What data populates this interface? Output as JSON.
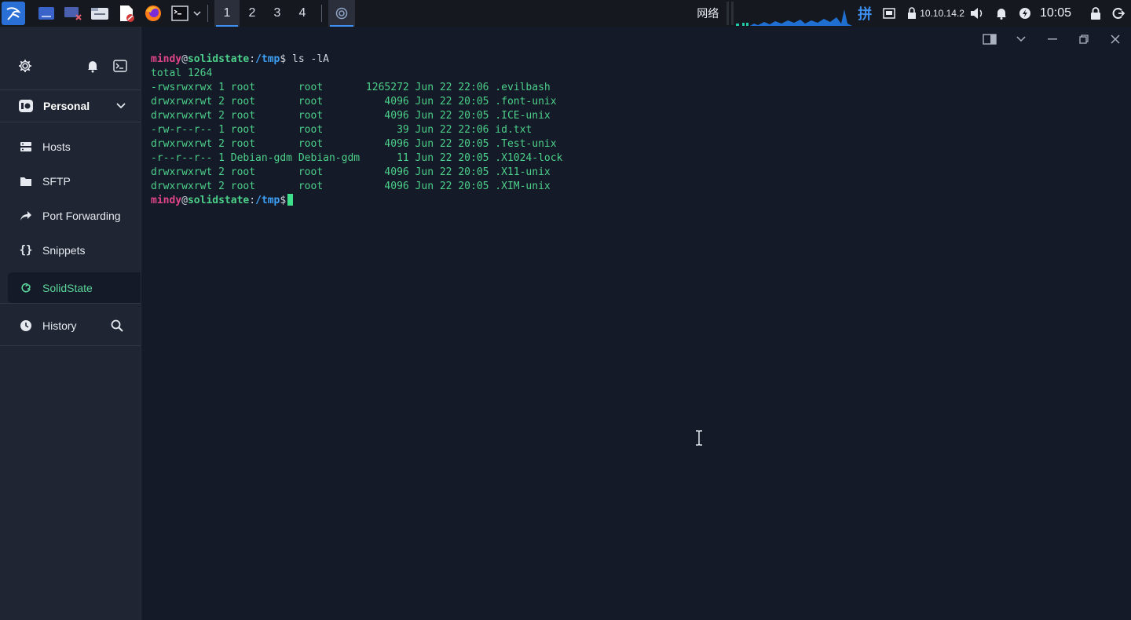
{
  "taskbar": {
    "workspaces": [
      "1",
      "2",
      "3",
      "4"
    ],
    "network_label": "网络",
    "ime_label": "拼",
    "ip_address": "10.10.14.2",
    "clock": "10:05",
    "accent": "#3d8ff0"
  },
  "sidebar": {
    "group_label": "Personal",
    "items": [
      {
        "label": "Hosts",
        "icon": "hosts-icon"
      },
      {
        "label": "SFTP",
        "icon": "folder-icon"
      },
      {
        "label": "Port Forwarding",
        "icon": "port-forward-icon"
      },
      {
        "label": "Snippets",
        "icon": "braces-icon"
      },
      {
        "label": "SolidState",
        "icon": "debian-swirl-icon",
        "selected": true
      },
      {
        "label": "History",
        "icon": "clock-icon"
      }
    ],
    "accent": "#5bd49a"
  },
  "terminal": {
    "prompt_user": "mindy",
    "prompt_at": "@",
    "prompt_host": "solidstate",
    "prompt_colon": ":",
    "prompt_path": "/tmp",
    "prompt_dollar": "$",
    "command": " ls -lA",
    "output": [
      "total 1264",
      "-rwsrwxrwx 1 root       root       1265272 Jun 22 22:06 .evilbash",
      "drwxrwxrwt 2 root       root          4096 Jun 22 20:05 .font-unix",
      "drwxrwxrwt 2 root       root          4096 Jun 22 20:05 .ICE-unix",
      "-rw-r--r-- 1 root       root            39 Jun 22 22:06 id.txt",
      "drwxrwxrwt 2 root       root          4096 Jun 22 20:05 .Test-unix",
      "-r--r--r-- 1 Debian-gdm Debian-gdm      11 Jun 22 20:05 .X1024-lock",
      "drwxrwxrwt 2 root       root          4096 Jun 22 20:05 .X11-unix",
      "drwxrwxrwt 2 root       root          4096 Jun 22 20:05 .XIM-unix"
    ],
    "colors": {
      "user": "#e0458a",
      "host": "#4cd08a",
      "path": "#3d9ff5",
      "text": "#4cd08a"
    }
  }
}
